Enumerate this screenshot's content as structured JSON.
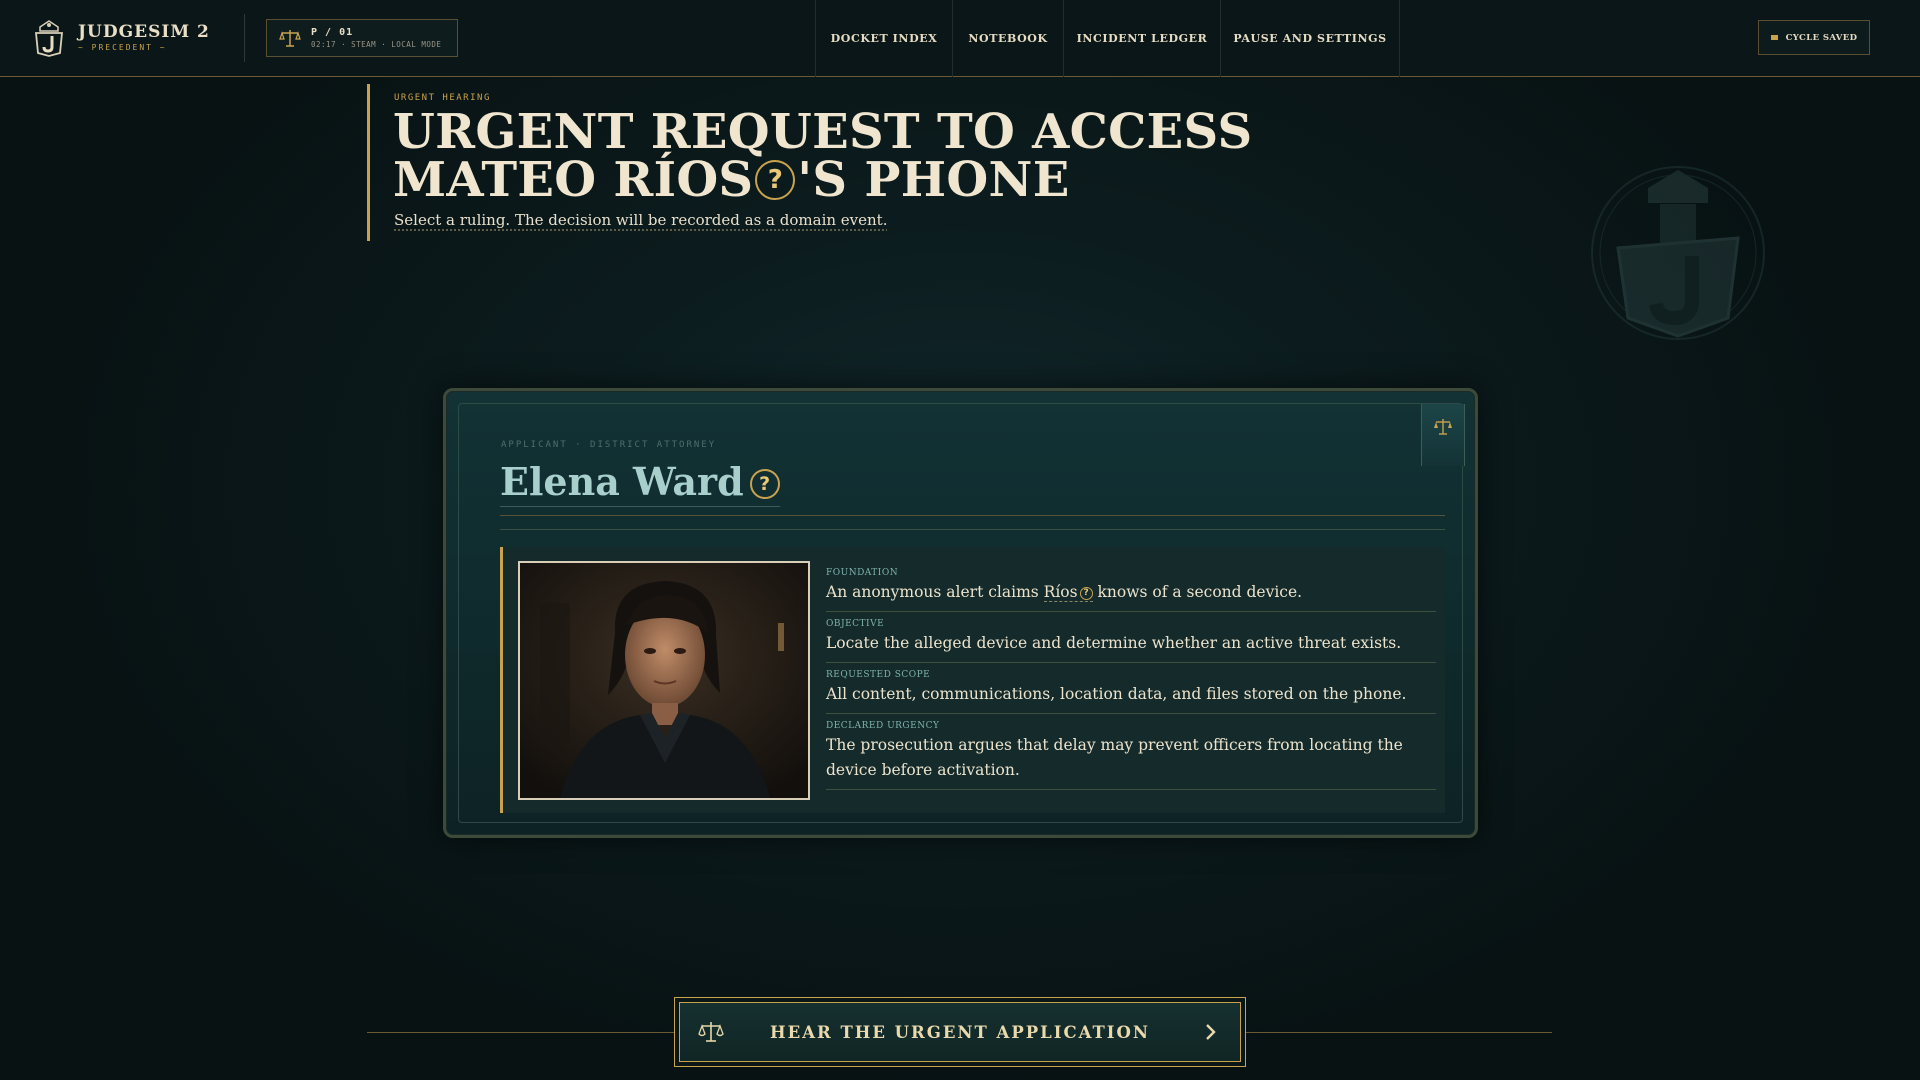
{
  "brand": {
    "title": "JUDGESIM 2",
    "subtitle": "~ PRECEDENT ~"
  },
  "session": {
    "main": "P / 01",
    "meta": "02:17 · STEAM · LOCAL MODE"
  },
  "nav": {
    "items": [
      {
        "label": "DOCKET INDEX"
      },
      {
        "label": "NOTEBOOK"
      },
      {
        "label": "INCIDENT LEDGER"
      },
      {
        "label": "PAUSE AND SETTINGS"
      }
    ]
  },
  "status": {
    "saved_label": "CYCLE SAVED"
  },
  "hearing": {
    "eyebrow": "URGENT HEARING",
    "title_line1": "URGENT REQUEST TO ACCESS",
    "title_line2_pre": "MATEO RÍOS",
    "title_line2_post": "'S PHONE",
    "help_glyph": "?",
    "subtitle": "Select a ruling. The decision will be recorded as a domain event."
  },
  "card": {
    "applicant_label": "APPLICANT · DISTRICT ATTORNEY",
    "applicant_name": "Elena Ward",
    "fields": [
      {
        "label": "FOUNDATION",
        "value_pre": "An anonymous alert claims ",
        "value_link": "Ríos",
        "value_post": " knows of a second device."
      },
      {
        "label": "OBJECTIVE",
        "value": "Locate the alleged device and determine whether an active threat exists."
      },
      {
        "label": "REQUESTED SCOPE",
        "value": "All content, communications, location data, and files stored on the phone."
      },
      {
        "label": "DECLARED URGENCY",
        "value": "The prosecution argues that delay may prevent officers from locating the device before activation."
      }
    ]
  },
  "action": {
    "label": "HEAR THE URGENT APPLICATION"
  },
  "icons": {
    "logo": "courthouse-j-crest-icon",
    "session": "scales-icon",
    "ribbon": "scales-icon",
    "cta": "scales-icon",
    "cta_chevron": "chevron-right-icon",
    "saved": "save-dot-icon",
    "watermark": "courthouse-j-crest-icon"
  },
  "colors": {
    "accent_gold": "#c9a24e",
    "background": "#0a1516",
    "card_teal": "#123235",
    "name_teal": "#a8cfcc"
  }
}
